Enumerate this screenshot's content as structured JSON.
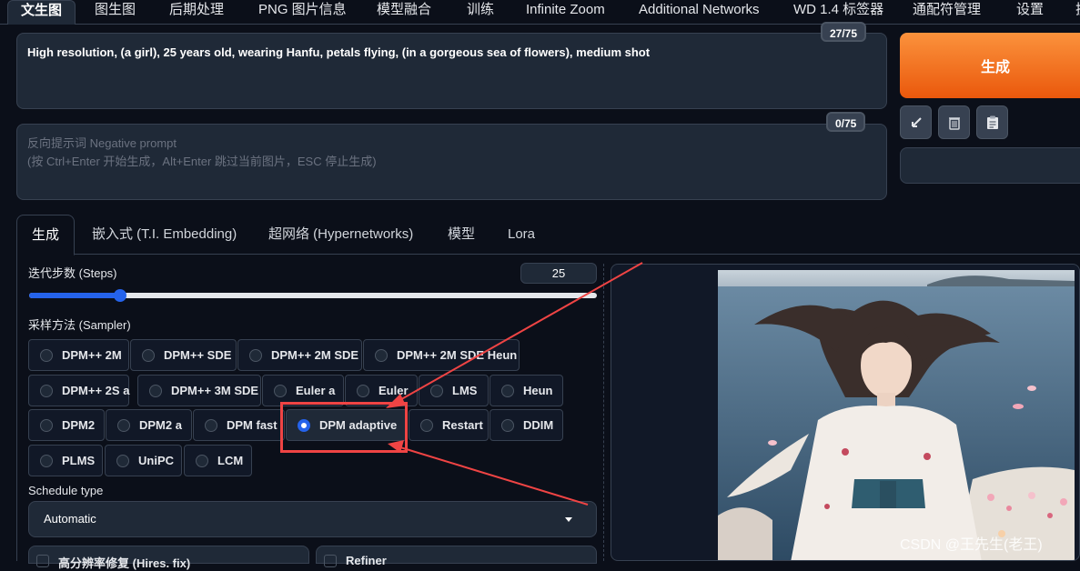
{
  "top_tabs": [
    "文生图",
    "图生图",
    "后期处理",
    "PNG 图片信息",
    "模型融合",
    "训练",
    "Infinite Zoom",
    "Additional Networks",
    "WD 1.4 标签器",
    "通配符管理",
    "设置",
    "扩"
  ],
  "prompt": {
    "value": "High resolution, (a girl), 25 years old, wearing Hanfu, petals flying, (in a gorgeous sea of flowers), medium shot",
    "counter": "27/75"
  },
  "negative_prompt": {
    "placeholder": "反向提示词 Negative prompt\n(按 Ctrl+Enter 开始生成，Alt+Enter 跳过当前图片，ESC 停止生成)",
    "counter": "0/75"
  },
  "generate_label": "生成",
  "tool_icons": [
    "arrow-icon",
    "trash-icon",
    "clipboard-icon"
  ],
  "sub_tabs": [
    "生成",
    "嵌入式 (T.I. Embedding)",
    "超网络 (Hypernetworks)",
    "模型",
    "Lora"
  ],
  "steps": {
    "label": "迭代步数 (Steps)",
    "value": "25",
    "fraction": 0.16
  },
  "sampler": {
    "label": "采样方法 (Sampler)",
    "rows": [
      [
        "DPM++ 2M",
        "DPM++ SDE",
        "DPM++ 2M SDE",
        "DPM++ 2M SDE Heun"
      ],
      [
        "DPM++ 2S a",
        "DPM++ 3M SDE",
        "Euler a",
        "Euler",
        "LMS",
        "Heun"
      ],
      [
        "DPM2",
        "DPM2 a",
        "DPM fast",
        "DPM adaptive",
        "Restart",
        "DDIM"
      ],
      [
        "PLMS",
        "UniPC",
        "LCM"
      ]
    ],
    "selected": "DPM adaptive"
  },
  "schedule": {
    "label": "Schedule type",
    "value": "Automatic"
  },
  "accordions": [
    "高分辨率修复 (Hires. fix)",
    "Refiner"
  ],
  "watermark": "CSDN @王先生(老王)",
  "colors": {
    "accent": "#2563eb",
    "generate": "#f97316",
    "annotation": "#ef4444"
  }
}
